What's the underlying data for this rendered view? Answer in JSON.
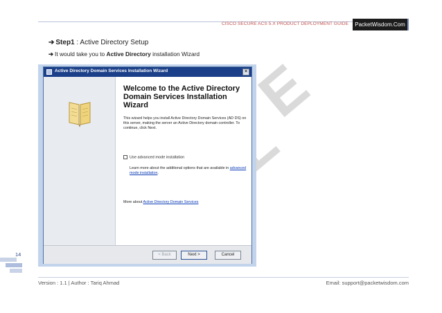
{
  "header": {
    "guide_title": "CISCO SECURE ACS 5.X PRODUCT DEPLOYMENT GUIDE",
    "brand": "PacketWisdom.Com"
  },
  "steps": {
    "step1_label": "Step1",
    "step1_text": " : Active Directory Setup",
    "step2_prefix": "It would take you to ",
    "step2_bold": "Active Directory",
    "step2_suffix": " installation Wizard"
  },
  "watermark": {
    "letter_1": "E",
    "letter_2": "L"
  },
  "wizard": {
    "window_title": "Active Directory Domain Services Installation Wizard",
    "close_glyph": "×",
    "heading": "Welcome to the Active Directory Domain Services Installation Wizard",
    "description": "This wizard helps you install Active Directory Domain Services (AD DS) on this server, making the server an Active Directory domain controller. To continue, click Next.",
    "checkbox_label": "Use advanced mode installation",
    "learn_prefix": "Learn more about the additional options that are available in ",
    "learn_link": "advanced mode installation",
    "learn_suffix": ".",
    "more_prefix": "More about ",
    "more_link": "Active Directory Domain Services",
    "buttons": {
      "back": "< Back",
      "next": "Next >",
      "cancel": "Cancel"
    }
  },
  "page_number": "14",
  "footer": {
    "left": "Version : 1.1 | Author : Tariq Ahmad",
    "right": "Email: support@packetwisdom.com"
  },
  "colors": {
    "header_text": "#c0504d",
    "brand_bg": "#1c1c1c",
    "titlebar": "#1b3f88",
    "link": "#0b3bb5"
  }
}
